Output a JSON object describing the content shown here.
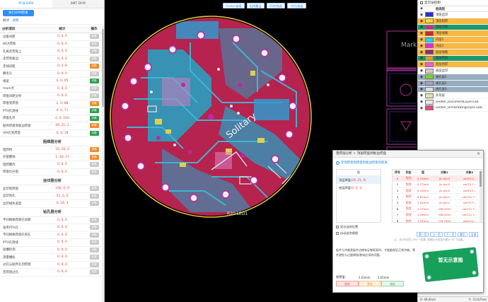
{
  "left_panel": {
    "tabs": [
      "PCB DFM",
      "SMT DFM"
    ],
    "run_button": "执行DFM检查",
    "subtabs": [
      "概述",
      "详情"
    ],
    "columns": [
      "分析项目",
      "统计",
      "操作"
    ],
    "action_label": "详情",
    "groups": [
      {
        "section": "",
        "items": [
          {
            "name": "设备间距",
            "stat": "0, 0, 0",
            "action": "gray"
          },
          {
            "name": "BGA焊盘",
            "stat": "0, 0, 0",
            "action": "gray"
          },
          {
            "name": "孔离走焊盘上",
            "stat": "0, 0, 0",
            "action": "gray"
          },
          {
            "name": "走焊到板边",
            "stat": "0, 0, 0",
            "action": "gray"
          },
          {
            "name": "走线间距",
            "stat": "0, 1, 8",
            "action": "orange"
          },
          {
            "name": "鳞毛头",
            "stat": "0, 0, 0",
            "action": "gray"
          },
          {
            "name": "线宽",
            "stat": "0, 0, 95",
            "action": "green"
          },
          {
            "name": "mark点",
            "stat": "0, 0, 0",
            "action": "gray"
          },
          {
            "name": "焊盘间距分析",
            "stat": "0, 0, 0",
            "action": "gray"
          },
          {
            "name": "焊盘到焊盘",
            "stat": "2, 0, 88",
            "action": "orange"
          },
          {
            "name": "PTH孔到线",
            "stat": "0, 0, 71",
            "action": "green"
          },
          {
            "name": "焊盘孔环",
            "stat": "0, 0, 100",
            "action": "green"
          },
          {
            "name": "贴件焊盘到板边焊盘",
            "stat": "29, 21, 1",
            "action": "orange"
          },
          {
            "name": "VIA孔到焊盘",
            "stat": "0, 0, 18",
            "action": "green"
          }
        ]
      },
      {
        "section": "阻焊层分析",
        "items": [
          {
            "name": "阻焊桥",
            "stat": "16, 20, 0",
            "action": "orange"
          },
          {
            "name": "开窗覆线",
            "stat": "1, 10, 17",
            "action": "orange"
          },
          {
            "name": "阻焊覆内",
            "stat": "0, 0, 0",
            "action": "gray"
          },
          {
            "name": "焊盘负开窗",
            "stat": "0, 0, 0",
            "action": "gray"
          }
        ]
      },
      {
        "section": "丝印层分析",
        "items": [
          {
            "name": "丝印到焊盘",
            "stat": "130, 0, 0",
            "action": "gray"
          },
          {
            "name": "丝印到孔",
            "stat": "52, 0, 0",
            "action": "gray"
          },
          {
            "name": "丝印线条宽度",
            "stat": "0, 18, 3",
            "action": "gray"
          }
        ]
      },
      {
        "section": "钻孔层分析",
        "items": [
          {
            "name": "不同网络焊盘孔间距",
            "stat": "0, 0, 0",
            "action": "gray"
          },
          {
            "name": "发夹PTH孔",
            "stat": "0, 0, 0",
            "action": "gray"
          },
          {
            "name": "不同网络焊盘孔到孔",
            "stat": "0, 0, 0",
            "action": "gray"
          },
          {
            "name": "PTH孔到线",
            "stat": "0, 0, 0",
            "action": "gray"
          },
          {
            "name": "短槽检测",
            "stat": "0, 0, 0",
            "action": "gray"
          },
          {
            "name": "测量槽标",
            "stat": "0, 0, 0",
            "action": "gray"
          },
          {
            "name": "过孔与贴件孔到焊盘",
            "stat": "0, 0, 0",
            "action": "gray"
          },
          {
            "name": "无焊盘过孔",
            "stat": "0, 0, 0",
            "action": "gray"
          }
        ]
      }
    ]
  },
  "toolbar": [
    "Gerber查看",
    "阻焊叠层",
    "2D转换器",
    "3D仿真器"
  ],
  "board": {
    "silk_text": "Solitary",
    "silk_text2": "R20  LED1",
    "right_labels": [
      "Mark"
    ]
  },
  "right_panel": {
    "title": "显示层控制",
    "header": "层类型",
    "layers": [
      {
        "name": "顶层丝印",
        "color": "#2c2bd8",
        "row_bg": "#ffffff"
      },
      {
        "name": "顶层阻焊",
        "color": "#f2da2a",
        "row_bg": "#f7b944"
      },
      {
        "name": "顶层焊盘",
        "color": "#cc2b7f",
        "row_bg": "#1c9a6a"
      },
      {
        "name": "顶层线路",
        "color": "#c92b2b",
        "row_bg": "#f7b944"
      },
      {
        "name": "内层1",
        "color": "#14d9ee",
        "row_bg": "#f7b944"
      },
      {
        "name": "内层2",
        "color": "#e12ad4",
        "row_bg": "#f7b944"
      },
      {
        "name": "底层线路",
        "color": "#8d2a7d",
        "row_bg": "#f7b944"
      },
      {
        "name": "底层焊盘",
        "color": "#d3a12a",
        "row_bg": "#1c9a6a"
      },
      {
        "name": "底层阻焊",
        "color": "#e85fd0",
        "row_bg": "#f7b944"
      },
      {
        "name": "底层丝印",
        "color": "#d8c8c0",
        "row_bg": "#ffffff"
      },
      {
        "name": "通孔层1",
        "color": "#7bd12a",
        "row_bg": "#97adc0"
      },
      {
        "name": "通孔层2",
        "color": "#9e9ec8",
        "row_bg": "#97adc0"
      },
      {
        "name": "通孔层3",
        "color": "#dcdcdc",
        "row_bg": "#97adc0"
      },
      {
        "name": "外形层",
        "color": "#dde6a8",
        "row_bg": "#ffffff"
      },
      {
        "name": "Gerber_DocumentLayer.GDL",
        "color": "#e8e8e8",
        "row_bg": "#ffffff"
      },
      {
        "name": "Gerber_DrillDrawingLayer.GDD",
        "color": "#e14a7a",
        "row_bg": "#ffffff"
      }
    ],
    "coord_x": "X: 46.0mm",
    "coord_y": "Y: -13.67mm"
  },
  "dialog": {
    "title": "阻焊层分析 > 顶层焊盘到板边焊盘",
    "info": "检测焊盘到焊盘到板边焊盘的距离",
    "layer_header": "层",
    "layer_items": [
      {
        "name": "顶层焊盘",
        "count": "(29, 21, 0)"
      },
      {
        "name": "底层焊盘",
        "count": "(0, 0, 1)"
      }
    ],
    "columns": [
      "序号",
      "状态",
      "值",
      "对象1",
      "对象2"
    ],
    "rows": [
      [
        "1",
        "危险",
        "0.19mm",
        "jlc-dyn3",
        "net59.0..."
      ],
      [
        "2",
        "危险",
        "0.77mm",
        "jlc-dyn3",
        "net75.7..."
      ],
      [
        "3",
        "危险",
        "0.70mm",
        "jlc-dyn3",
        "net59.0..."
      ],
      [
        "4",
        "危险",
        "0.81mm",
        "jlc-dyn1",
        "net131.7..."
      ],
      [
        "5",
        "危险",
        "1.02mm",
        "jlc-dyn1",
        "net75.7..."
      ],
      [
        "6",
        "危险",
        "1.17mm",
        "r98.3291",
        "net131.7..."
      ],
      [
        "7",
        "危险",
        "1.29mm",
        "r98.3291",
        "net131.7..."
      ],
      [
        "8",
        "危险",
        "1.33mm",
        "r78.7402",
        "net53.0..."
      ]
    ],
    "check1": "显示当前位置",
    "check2": "自动适合视图",
    "pager": [
      "第一页",
      "上一页",
      "下一页",
      "最后",
      "全部"
    ],
    "note": "注：该分析项共 264 个结果, 数据太大的话只展示 50 个结果。",
    "description": "板件与冲裁类板件边缘有足够距离时，才能能保证正常冲裁。零件避免与过量焊接/影响后续的问题。",
    "preview_text": "暂无示意图",
    "warn_label": "报警值：",
    "warn_values": [
      "2.03mm",
      "3.05mm"
    ],
    "scale": [
      "危险",
      "警告",
      "良好"
    ]
  }
}
